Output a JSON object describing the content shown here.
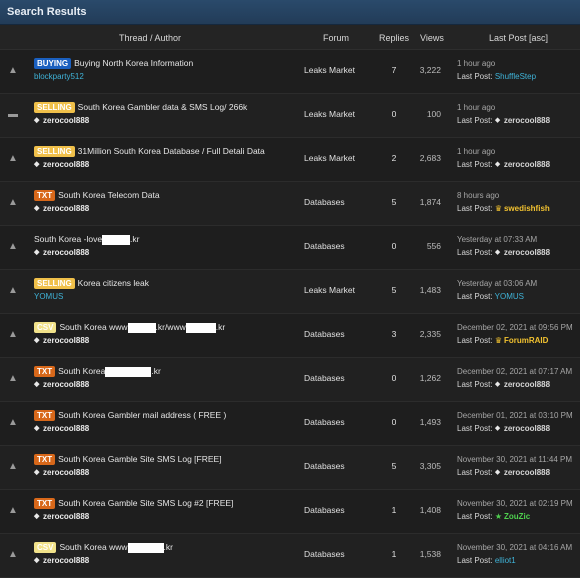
{
  "title": "Search Results",
  "columns": {
    "thread": "Thread / Author",
    "forum": "Forum",
    "replies": "Replies",
    "views": "Views",
    "last": "Last Post [asc]"
  },
  "rows": [
    {
      "icon": "fire-icon",
      "prefix": "BUYING",
      "ptype": "buying",
      "title": "Buying North Korea Information",
      "author": "blockparty512",
      "author_style": "cyan",
      "forum": "Leaks Market",
      "replies": "7",
      "views": "3,222",
      "time": "1 hour ago",
      "lp_label": "Last Post:",
      "lp_user": "ShuffleStep",
      "lp_style": "cyan"
    },
    {
      "icon": "folder-icon",
      "prefix": "SELLING",
      "ptype": "selling",
      "title": "South Korea Gambler data & SMS Log/ 266k",
      "author": "zerocool888",
      "author_style": "gem",
      "forum": "Leaks Market",
      "replies": "0",
      "views": "100",
      "time": "1 hour ago",
      "lp_label": "Last Post:",
      "lp_user": "zerocool888",
      "lp_style": "gem"
    },
    {
      "icon": "fire-icon",
      "prefix": "SELLING",
      "ptype": "selling",
      "title": "31Million South Korea Database / Full Detali Data",
      "author": "zerocool888",
      "author_style": "gem",
      "forum": "Leaks Market",
      "replies": "2",
      "views": "2,683",
      "time": "1 hour ago",
      "lp_label": "Last Post:",
      "lp_user": "zerocool888",
      "lp_style": "gem"
    },
    {
      "icon": "fire-icon",
      "prefix": "TXT",
      "ptype": "txt",
      "title": "South Korea Telecom Data",
      "author": "zerocool888",
      "author_style": "gem",
      "forum": "Databases",
      "replies": "5",
      "views": "1,874",
      "time": "8 hours ago",
      "lp_label": "Last Post:",
      "lp_user": "swedishfish",
      "lp_style": "gold"
    },
    {
      "icon": "fire-icon",
      "prefix": "",
      "ptype": "",
      "title": "South Korea -love",
      "title_after": ".kr",
      "redact_w": 28,
      "author": "zerocool888",
      "author_style": "gem",
      "forum": "Databases",
      "replies": "0",
      "views": "556",
      "time": "Yesterday at 07:33 AM",
      "lp_label": "Last Post:",
      "lp_user": "zerocool888",
      "lp_style": "gem"
    },
    {
      "icon": "fire-icon",
      "prefix": "SELLING",
      "ptype": "selling",
      "title": "Korea citizens leak",
      "author": "YOMUS",
      "author_style": "cyan",
      "forum": "Leaks Market",
      "replies": "5",
      "views": "1,483",
      "time": "Yesterday at 03:06 AM",
      "lp_label": "Last Post:",
      "lp_user": "YOMUS",
      "lp_style": "cyan"
    },
    {
      "icon": "fire-icon",
      "prefix": "CSV",
      "ptype": "csv",
      "title": "South Korea www",
      "title_mid": ".kr/www",
      "title_after": ".kr",
      "redact_w": 28,
      "redact2_w": 30,
      "author": "zerocool888",
      "author_style": "gem",
      "forum": "Databases",
      "replies": "3",
      "views": "2,335",
      "time": "December 02, 2021 at 09:56 PM",
      "lp_label": "Last Post:",
      "lp_user": "ForumRAID",
      "lp_style": "gold"
    },
    {
      "icon": "fire-icon",
      "prefix": "TXT",
      "ptype": "txt",
      "title": "South Korea",
      "title_after": ".kr",
      "redact_w": 46,
      "author": "zerocool888",
      "author_style": "gem",
      "forum": "Databases",
      "replies": "0",
      "views": "1,262",
      "time": "December 02, 2021 at 07:17 AM",
      "lp_label": "Last Post:",
      "lp_user": "zerocool888",
      "lp_style": "gem"
    },
    {
      "icon": "fire-icon",
      "prefix": "TXT",
      "ptype": "txt",
      "title": "South Korea Gambler mail address ( FREE )",
      "author": "zerocool888",
      "author_style": "gem",
      "forum": "Databases",
      "replies": "0",
      "views": "1,493",
      "time": "December 01, 2021 at 03:10 PM",
      "lp_label": "Last Post:",
      "lp_user": "zerocool888",
      "lp_style": "gem"
    },
    {
      "icon": "fire-icon",
      "prefix": "TXT",
      "ptype": "txt",
      "title": "South Korea Gamble Site SMS Log [FREE]",
      "author": "zerocool888",
      "author_style": "gem",
      "forum": "Databases",
      "replies": "5",
      "views": "3,305",
      "time": "November 30, 2021 at 11:44 PM",
      "lp_label": "Last Post:",
      "lp_user": "zerocool888",
      "lp_style": "gem"
    },
    {
      "icon": "fire-icon",
      "prefix": "TXT",
      "ptype": "txt",
      "title": "South Korea Gamble Site SMS Log #2 [FREE]",
      "author": "zerocool888",
      "author_style": "gem",
      "forum": "Databases",
      "replies": "1",
      "views": "1,408",
      "time": "November 30, 2021 at 02:19 PM",
      "lp_label": "Last Post:",
      "lp_user": "ZouZic",
      "lp_style": "green"
    },
    {
      "icon": "fire-icon",
      "prefix": "CSV",
      "ptype": "csv",
      "title": "South Korea www",
      "title_after": ".kr",
      "redact_w": 36,
      "author": "zerocool888",
      "author_style": "gem",
      "forum": "Databases",
      "replies": "1",
      "views": "1,538",
      "time": "November 30, 2021 at 04:16 AM",
      "lp_label": "Last Post:",
      "lp_user": "elliot1",
      "lp_style": "cyan"
    }
  ]
}
